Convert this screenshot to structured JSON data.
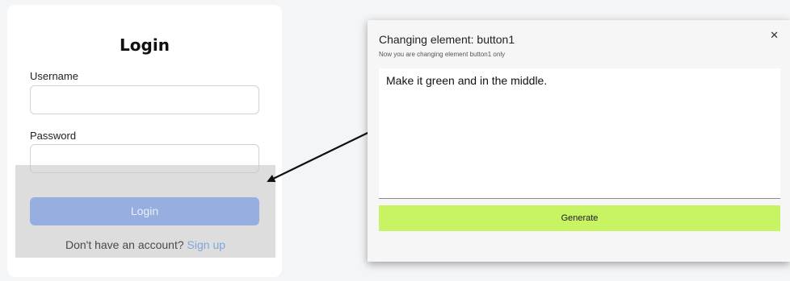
{
  "login": {
    "title": "Login",
    "username_label": "Username",
    "username_value": "",
    "password_label": "Password",
    "password_value": "",
    "login_button": "Login",
    "signup_prompt": "Don't have an account?",
    "signup_link": "Sign up"
  },
  "modal": {
    "title": "Changing element: button1",
    "subtitle": "Now you are changing element button1 only",
    "close_icon": "close-icon",
    "prompt_text": "Make it green and in the middle.",
    "generate_button": "Generate"
  },
  "colors": {
    "page_background": "#f4f5f7",
    "login_button": "#96aee0",
    "signup_link": "#7fa6de",
    "generate_button": "#c8f464",
    "overlay": "#c8c8c8"
  }
}
